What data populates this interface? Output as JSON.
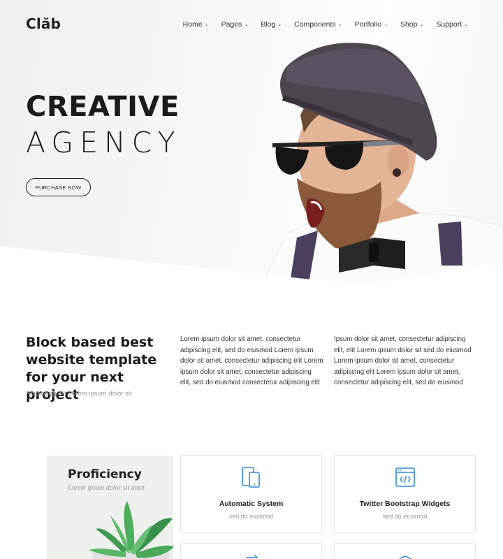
{
  "brand": {
    "logo": "Clăb"
  },
  "nav": {
    "items": [
      {
        "label": "Home"
      },
      {
        "label": "Pages"
      },
      {
        "label": "Blog"
      },
      {
        "label": "Components"
      },
      {
        "label": "Portfolio"
      },
      {
        "label": "Shop"
      },
      {
        "label": "Support"
      }
    ],
    "chevron": "⌄"
  },
  "hero": {
    "title_line1": "CREATIVE",
    "title_line2": "AGENCY",
    "cta_label": "PURCHASE NOW"
  },
  "about": {
    "heading": "Block based best website template for your next project",
    "subheading": "Adipiscing elit Lorem ipsum dolor sit",
    "column1": "Lorem ipsum dolor sit amet, consectetur adipiscing elit, sed do eiusmod Lorem ipsum dolor sit amet, consectetur adipiscing elit Lorem ipsum dolor sit amet, consectetur adipiscing elit, sed do eiusmod consectetur adipiscing elit",
    "column2": "Ipsum dolor sit amet, consectetur adipiscing elit, elit Lorem ipsum dolor sit sed do eiusmod Lorem ipsum dolor sit amet, consectetur adipiscing elit Lorem ipsum dolor sit amet, consectetur adipiscing elit, sed do eiusmod"
  },
  "proficiency": {
    "title": "Proficiency",
    "subtitle": "Lorem ipsum dolor sit amet"
  },
  "features": [
    {
      "title": "Automatic System",
      "subtitle": "sed do eiusmod",
      "icon": "devices-icon"
    },
    {
      "title": "Twitter Bootstrap Widgets",
      "subtitle": "sed do eiusmod",
      "icon": "code-window-icon"
    }
  ],
  "colors": {
    "accent": "#2f86d6",
    "text": "#1b1b1b",
    "muted": "#999999"
  }
}
